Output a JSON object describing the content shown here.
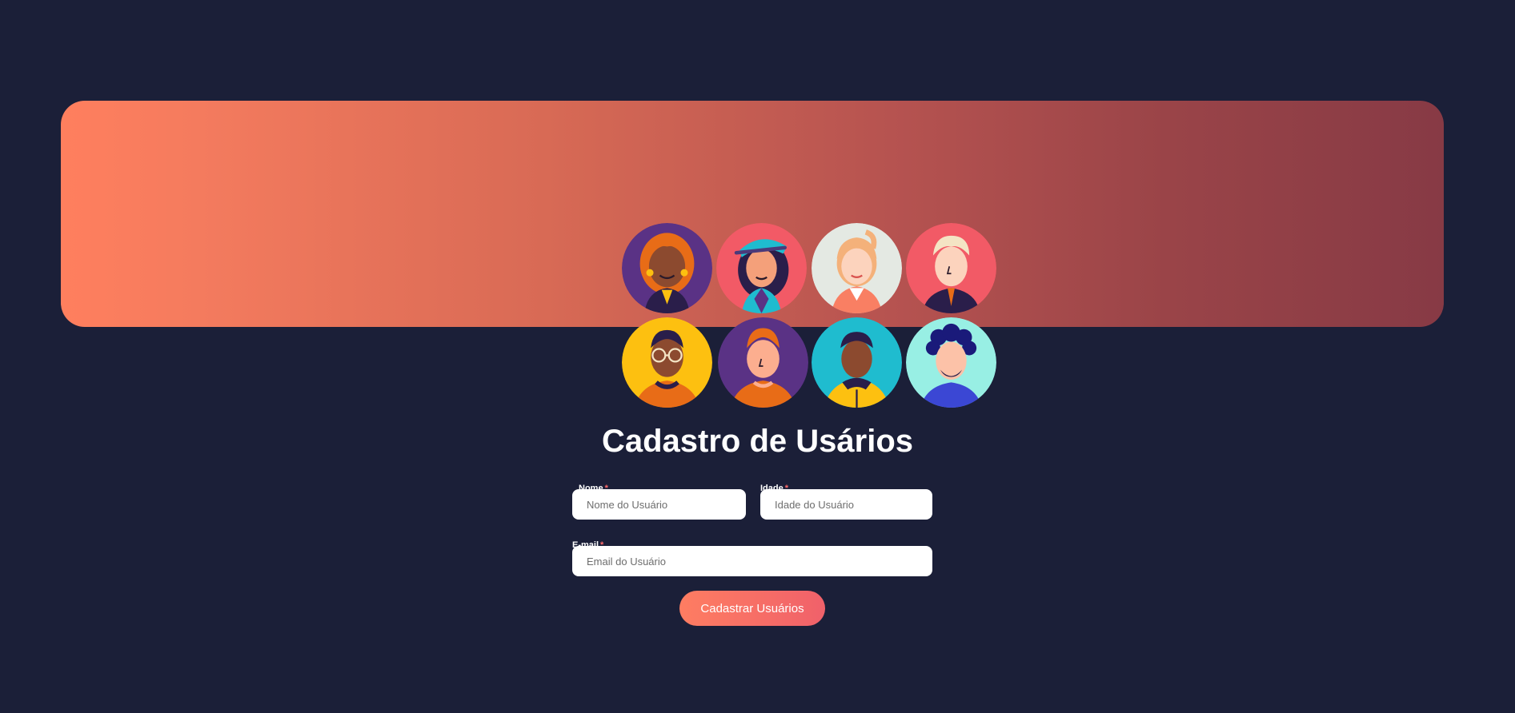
{
  "banner": {
    "avatars": [
      {
        "name": "woman-orange-curly-hair",
        "bg": "#5a3285"
      },
      {
        "name": "woman-teal-cap",
        "bg": "#f25a66"
      },
      {
        "name": "woman-blonde-ponytail",
        "bg": "#e4e9e3"
      },
      {
        "name": "man-blonde-hair",
        "bg": "#f25a66"
      },
      {
        "name": "man-glasses",
        "bg": "#fdc010"
      },
      {
        "name": "man-redhead",
        "bg": "#5a3285"
      },
      {
        "name": "man-yellow-jacket",
        "bg": "#1fbccf"
      },
      {
        "name": "man-curly-beard",
        "bg": "#98efe4"
      }
    ]
  },
  "form": {
    "title": "Cadastro de Usários",
    "name_label": "Nome",
    "name_placeholder": "Nome do Usuário",
    "age_label": "Idade",
    "age_placeholder": "Idade do Usuário",
    "email_label": "E-mail",
    "email_placeholder": "Email do Usuário",
    "required_mark": "*",
    "submit_label": "Cadastrar Usuários"
  },
  "colors": {
    "background": "#1b1f38",
    "banner_start": "#ff7f5e",
    "banner_end": "#873a45",
    "button_start": "#fe7d62",
    "button_end": "#f0616a",
    "required": "#ff6b6b"
  }
}
